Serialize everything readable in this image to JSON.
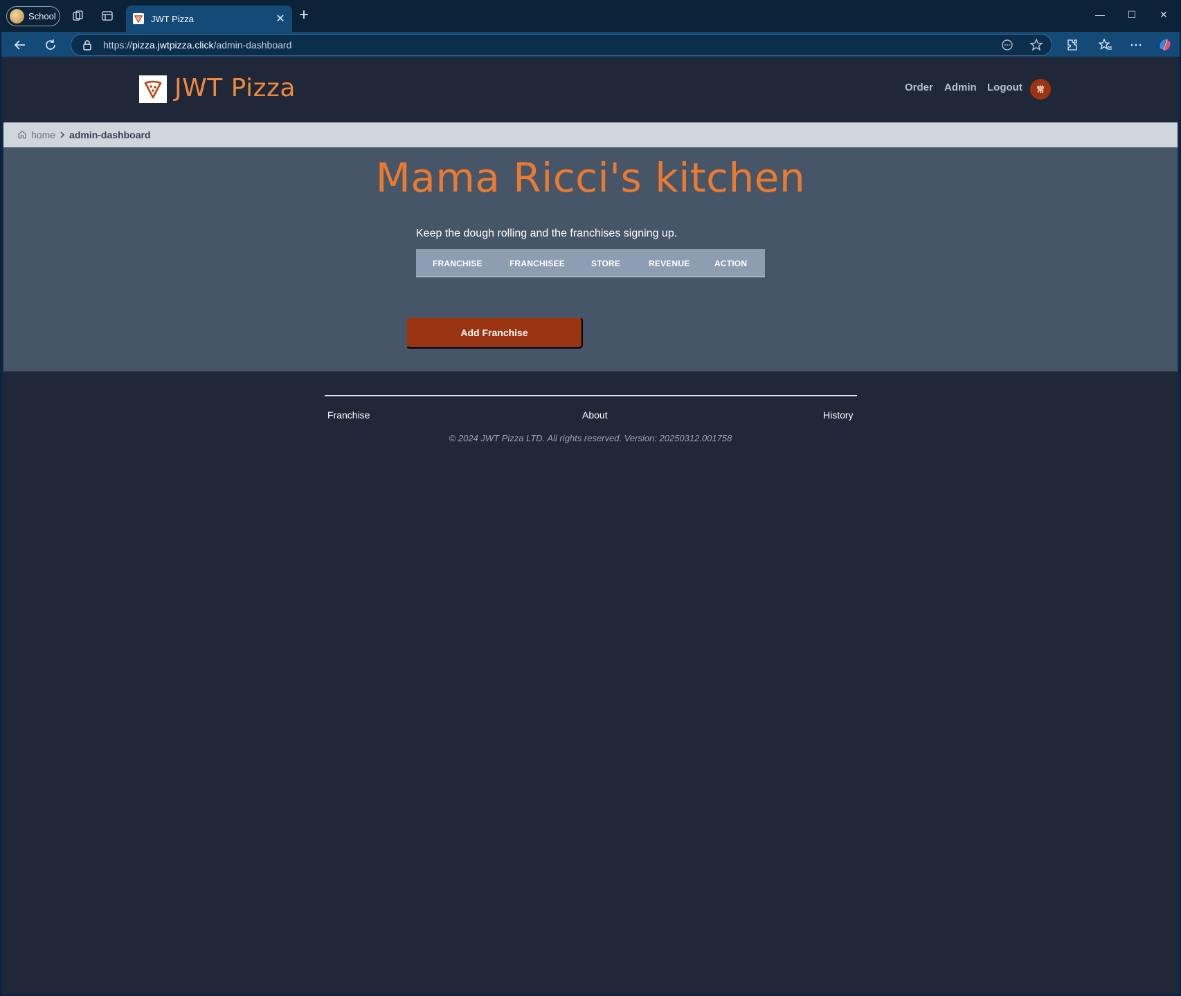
{
  "browser": {
    "profile_label": "School",
    "tab_title": "JWT Pizza",
    "url_scheme": "https://",
    "url_host": "pizza.jwtpizza.click",
    "url_path": "/admin-dashboard"
  },
  "site": {
    "brand": "JWT Pizza",
    "nav": {
      "order": "Order",
      "admin": "Admin",
      "logout": "Logout"
    },
    "avatar_initials": "常",
    "breadcrumb": {
      "home": "home",
      "current": "admin-dashboard"
    }
  },
  "main": {
    "title": "Mama Ricci's kitchen",
    "tagline": "Keep the dough rolling and the franchises signing up.",
    "table_headers": [
      "FRANCHISE",
      "FRANCHISEE",
      "STORE",
      "REVENUE",
      "ACTION"
    ],
    "add_button": "Add Franchise"
  },
  "footer": {
    "links": [
      "Franchise",
      "About",
      "History"
    ],
    "copyright": "© 2024 JWT Pizza LTD. All rights reserved. Version: 20250312.001758"
  },
  "colors": {
    "brand_orange": "#ea7a2f",
    "button_red": "#9a3412",
    "page_dark": "#1f2738",
    "main_slate": "#475569"
  }
}
